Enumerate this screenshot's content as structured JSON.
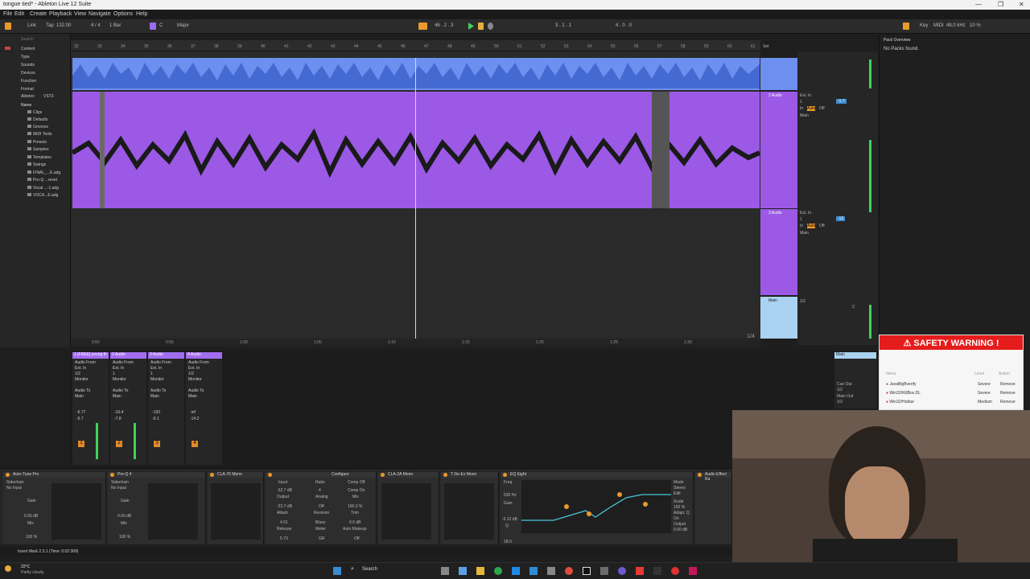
{
  "window": {
    "title": "tongue tied* - Ableton Live 12 Suite",
    "min": "—",
    "max": "❐",
    "close": "✕"
  },
  "menu": [
    "File",
    "Edit",
    "Create",
    "Playback",
    "View",
    "Navigate",
    "Options",
    "Help"
  ],
  "transport": {
    "link": "Link",
    "tap": "Tap",
    "tempo": "132.00",
    "time_sig": "4 / 4",
    "quantize": "1 Bar",
    "key": "C",
    "scale": "Major",
    "position": "46 . 2 . 3",
    "loop_start": "3 . 1 . 1",
    "loop_len": "4 . 0 . 0",
    "key_btn": "Key",
    "midi": "MIDI",
    "cpu": "48.0 kHz",
    "cpu_pct": "10 %"
  },
  "browser": {
    "search_placeholder": "Search",
    "categories": [
      "Content",
      "Type",
      "Sounds",
      "Devices",
      "Function",
      "Format",
      "Ableton",
      "VST3"
    ],
    "places_title": "Name",
    "items": [
      "Clips",
      "Defaults",
      "Grooves",
      "MIDI Tools",
      "Presets",
      "Samples",
      "Templates",
      "Swings",
      "FINAL_...E.adg",
      "Pro-Q ...reset",
      "Vocal ...-1.adg",
      "VOCA...E.adg"
    ]
  },
  "ruler": {
    "bars": [
      "32",
      "33",
      "34",
      "35",
      "36",
      "37",
      "38",
      "39",
      "40",
      "41",
      "42",
      "43",
      "44",
      "45",
      "46",
      "47",
      "48",
      "49",
      "50",
      "51",
      "52",
      "53",
      "54",
      "55",
      "56",
      "57",
      "58",
      "59",
      "60",
      "61"
    ]
  },
  "timebar": {
    "marks": [
      "0:50",
      "0:55",
      "1:00",
      "1:05",
      "1:10",
      "1:15",
      "1:20",
      "1:25",
      "1:30"
    ],
    "fraction": "1/4"
  },
  "tracks": {
    "t1": "2 Audio",
    "t2": "3 Audio",
    "main": "Main",
    "set": "Set"
  },
  "mixer": {
    "ext_in": "Ext. In",
    "in": "In",
    "auto": "Auto",
    "off": "Off",
    "main": "Main",
    "vol1": "-1.7",
    "vol2": "-13",
    "one": "1",
    "c": "C",
    "two": "2",
    "one_two": "1/2"
  },
  "packs": {
    "title": "Pack Overview",
    "empty": "No Packs found."
  },
  "channels": [
    {
      "name": "1 [FREE] young th",
      "from": "Audio From",
      "src": "Ext. In",
      "ch": "1/2",
      "mon": "Monitor",
      "to": "Audio To",
      "dst": "Main",
      "peak": "-6.77",
      "vol": "-6.7",
      "num": "1"
    },
    {
      "name": "2 Audio",
      "from": "Audio From",
      "src": "Ext. In",
      "ch": "1",
      "mon": "Monitor",
      "to": "Audio To",
      "dst": "Main",
      "peak": "-10.4",
      "vol": "-7.8",
      "num": "2"
    },
    {
      "name": "3 Audio",
      "from": "Audio From",
      "src": "Ext. In",
      "ch": "1",
      "mon": "Monitor",
      "to": "Audio To",
      "dst": "Main",
      "peak": "-150",
      "vol": "-9.1",
      "num": "3"
    },
    {
      "name": "4 Audio",
      "from": "Audio From",
      "src": "Ext. In",
      "ch": "1/2",
      "mon": "Monitor",
      "to": "Audio To",
      "dst": "Main",
      "peak": "-inf",
      "vol": "-14.2",
      "num": "4"
    }
  ],
  "main_channel": {
    "name": "Main",
    "cue": "Cue Out",
    "cue_val": "1/2",
    "main_out": "Main Out",
    "main_val": "1/2"
  },
  "devices": [
    {
      "name": "Auto-Tune Pro",
      "side": "Sidechain",
      "no_input": "No Input",
      "gain": "Gain",
      "gval": "0.00 dB",
      "mix": "Mix",
      "mval": "100 %"
    },
    {
      "name": "Pro-Q 4",
      "side": "Sidechain",
      "no_input": "No Input",
      "gain": "Gain",
      "gval": "0.00 dB",
      "mix": "Mix",
      "mval": "100 %"
    },
    {
      "name": "CLA-76 Mono"
    },
    {
      "name": "Configure",
      "input": "Input",
      "ival": "-32.7 dB",
      "output": "Output",
      "oval": "-22.7 dB",
      "attack": "Attack",
      "aval": "4.01",
      "release": "Release",
      "rval": "5.73",
      "ratio": "Ratio",
      "rtv": "4",
      "analog": "Analog",
      "off": "Off",
      "revision": "Revision",
      "bluey": "Bluey",
      "meter": "Meter",
      "gr": "GR",
      "comp_off": "Comp Off",
      "comp_on": "Comp On",
      "mix": "Mix",
      "mixv": "100.0 %",
      "trim": "Trim",
      "trimv": "0.0 dB",
      "auto_makeup": "Auto Makeup",
      "am_off": "Off"
    },
    {
      "name": "CLA-2A Mono"
    },
    {
      "name": "T-De-Es Mono"
    },
    {
      "name": "EQ Eight",
      "freq": "Freq",
      "fval": "530 Hz",
      "gain": "Gain",
      "gval": "-5.12 dB",
      "q": "Q",
      "qval": "18.0",
      "mode": "Mode",
      "mode_val": "Stereo",
      "edit": "Edit",
      "scale": "Scale",
      "scale_val": "100 %",
      "adapt": "Adapt. Q",
      "on": "On",
      "output": "Output",
      "out_val": "0.00 dB"
    },
    {
      "name": "Audio Effect Ra"
    }
  ],
  "status": {
    "text": "Insert Mark 2.3.1 (Time: 0:02:368)"
  },
  "warning": {
    "title": "⚠ SAFETY WARNING !",
    "cols": [
      "Items",
      "Level",
      "Action"
    ],
    "rows": [
      [
        "JavaBigBverify",
        "Severe",
        "Remove"
      ],
      [
        "Win32/KillBox.DL",
        "Severe",
        "Remove"
      ],
      [
        "Win32/Hotbar",
        "Medium",
        "Remove"
      ]
    ]
  },
  "taskbar": {
    "temp": "22°C",
    "weather": "Partly cloudy",
    "search": "Search"
  },
  "colors": {
    "clip_blue": "#6d8ff0",
    "clip_purple": "#9b59e6",
    "accent_orange": "#e99a2b",
    "warning_red": "#e51c1c"
  }
}
